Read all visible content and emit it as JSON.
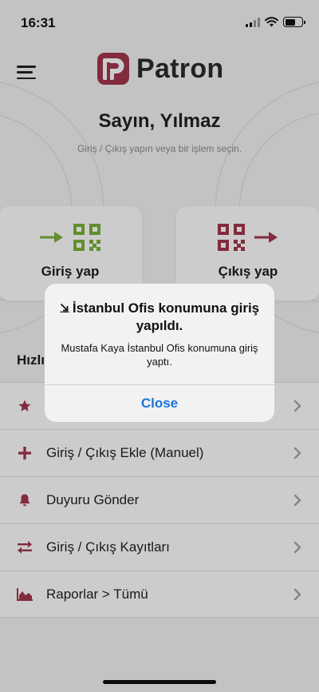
{
  "status_bar": {
    "time": "16:31"
  },
  "header": {
    "brand_name": "Patron"
  },
  "greeting": "Sayın, Yılmaz",
  "subtitle": "Giriş / Çıkış yapın veya bir işlem seçin.",
  "actions": {
    "check_in_label": "Giriş yap",
    "check_out_label": "Çıkış yap"
  },
  "quick_section_title": "Hızlı",
  "list_items": [
    {
      "label": "",
      "icon": "star-icon"
    },
    {
      "label": "Giriş / Çıkış Ekle (Manuel)",
      "icon": "plus-icon"
    },
    {
      "label": "Duyuru Gönder",
      "icon": "bell-icon"
    },
    {
      "label": "Giriş / Çıkış Kayıtları",
      "icon": "swap-arrows-icon"
    },
    {
      "label": "Raporlar > Tümü",
      "icon": "area-chart-icon"
    }
  ],
  "alert": {
    "title": "İstanbul Ofis konumuna giriş yapıldı.",
    "message": "Mustafa Kaya İstanbul Ofis konumuna giriş yaptı.",
    "button_label": "Close"
  },
  "colors": {
    "brand": "#a3384e",
    "check_in_green": "#7bb33b",
    "alert_button_blue": "#1a73d9"
  }
}
